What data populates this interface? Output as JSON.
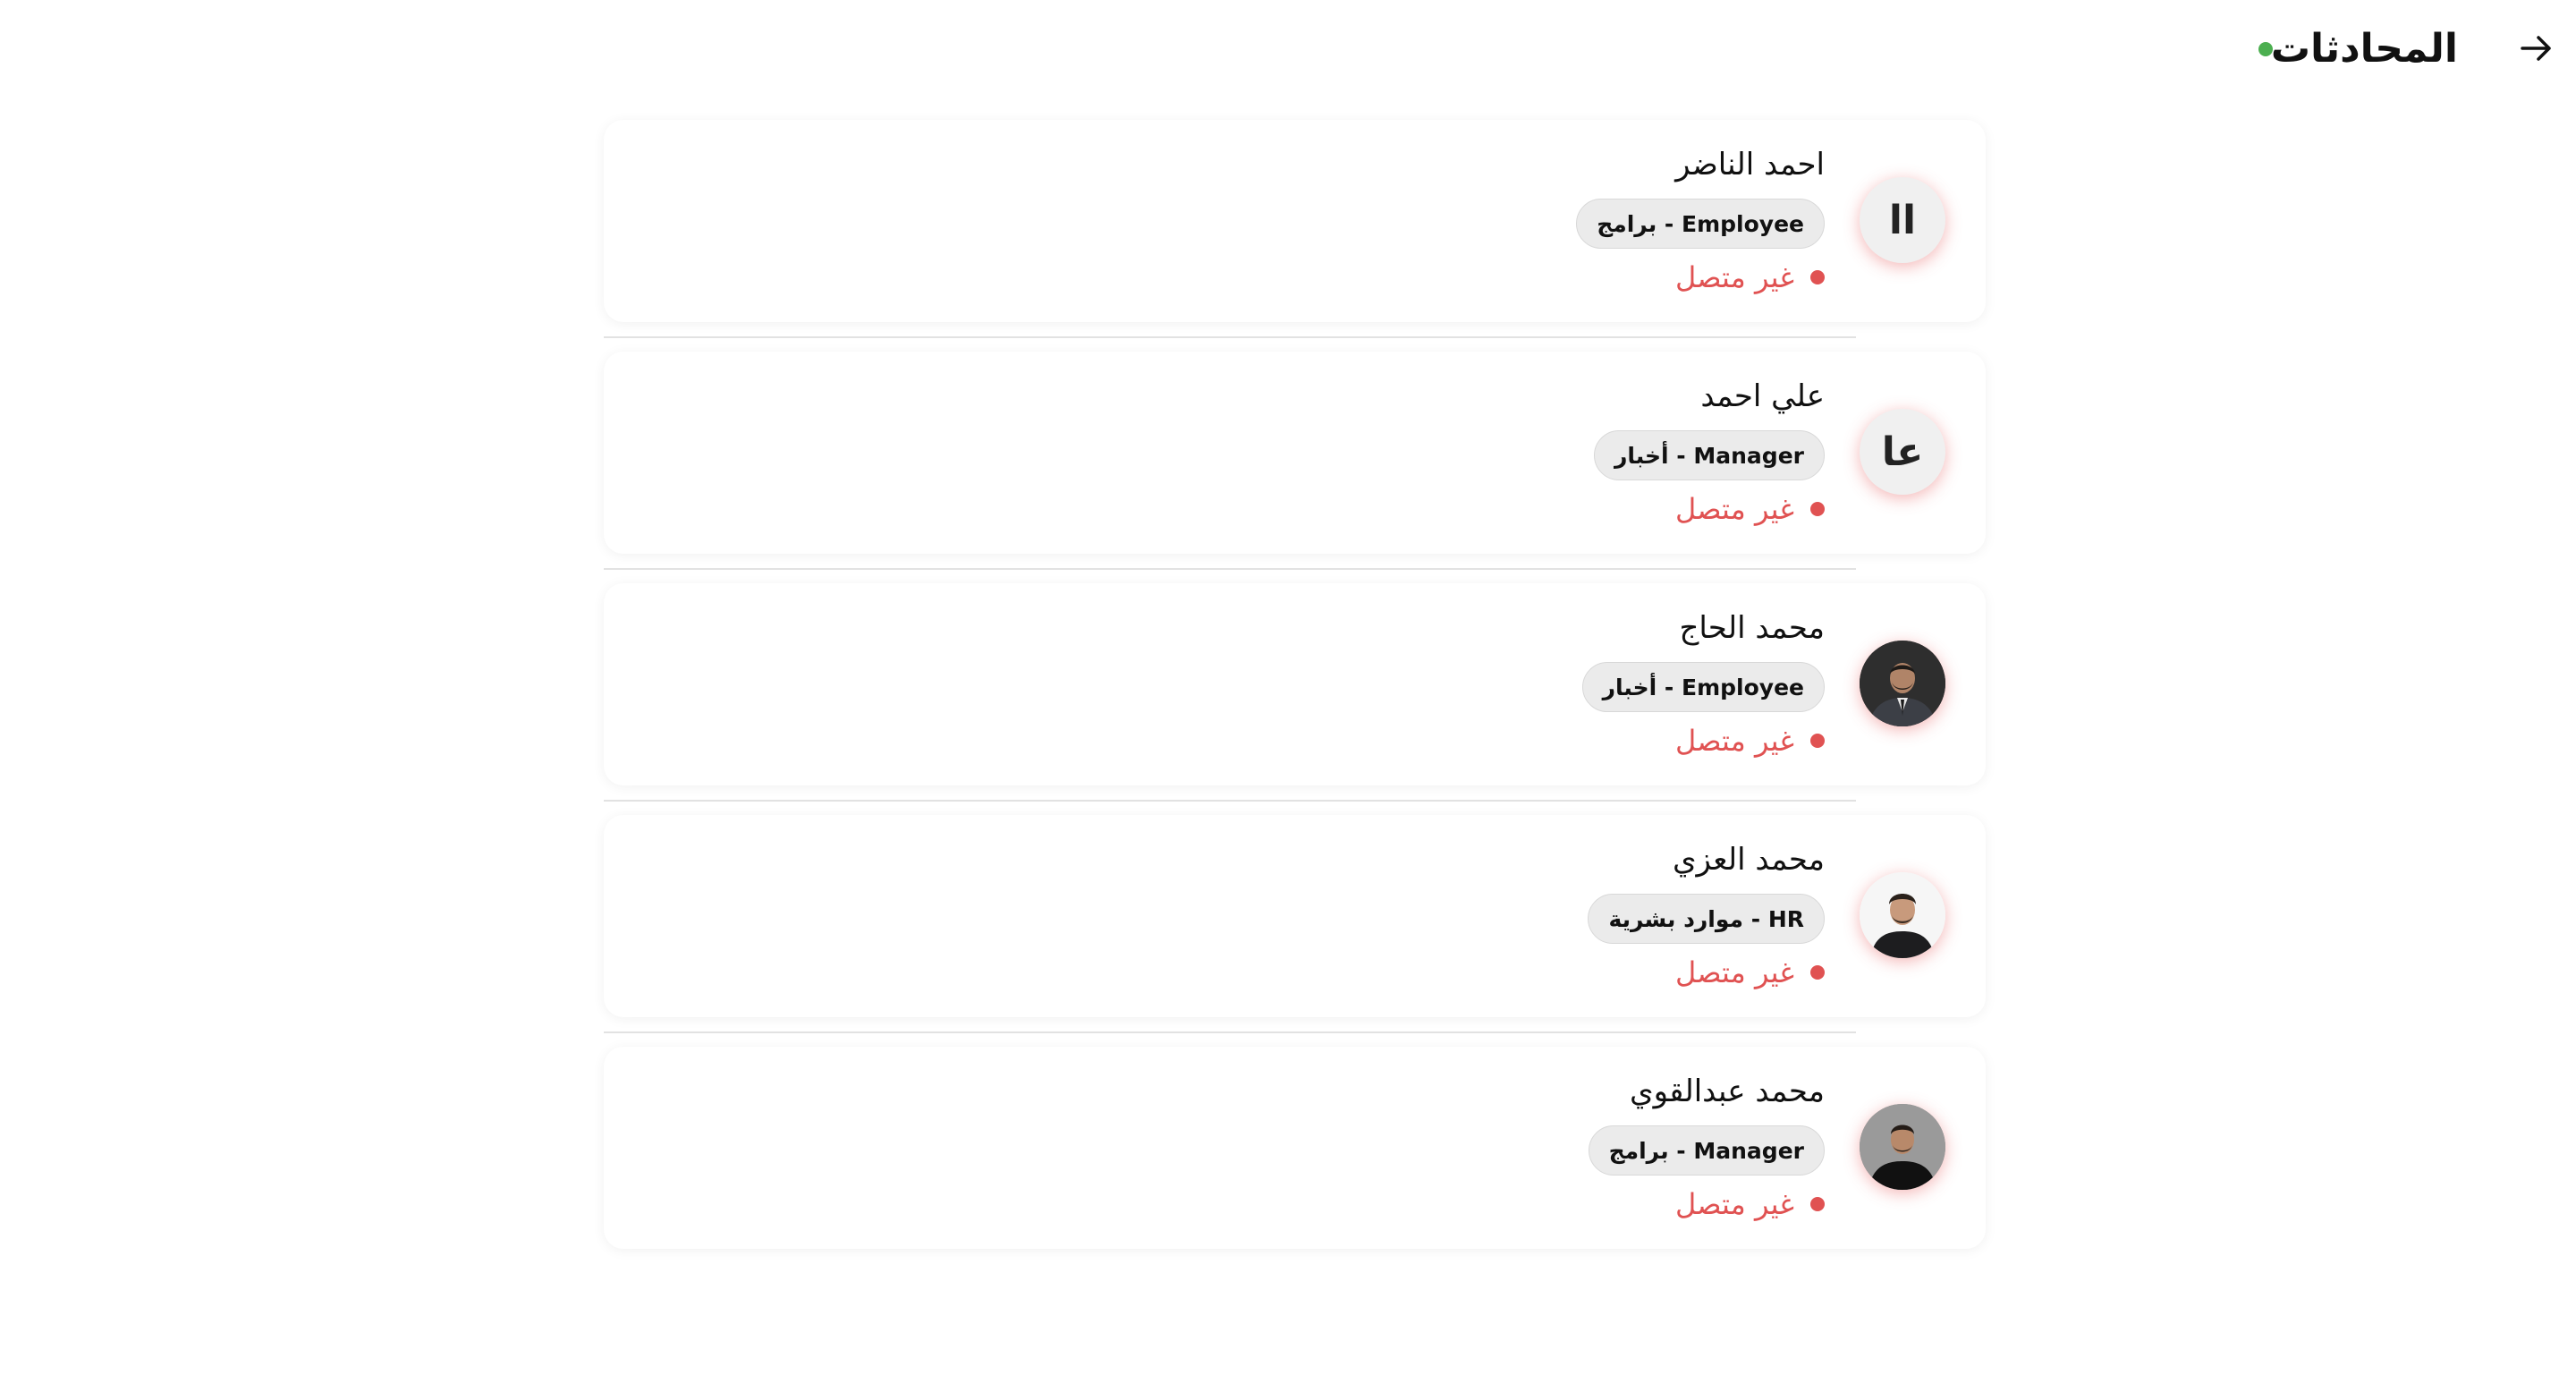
{
  "header": {
    "title": "المحادثات",
    "back_icon": "arrow-right-icon",
    "online_indicator_color": "#4caf50"
  },
  "colors": {
    "offline": "#e05252",
    "avatar_glow": "#e55353",
    "tag_bg": "#ebebeb"
  },
  "contacts": [
    {
      "name": "احمد الناضر",
      "tag": "Employee - برامج",
      "status": "غير متصل",
      "initials": "اا",
      "avatar_type": "initials"
    },
    {
      "name": "علي احمد",
      "tag": "Manager - أخبار",
      "status": "غير متصل",
      "initials": "عا",
      "avatar_type": "initials"
    },
    {
      "name": "محمد الحاج",
      "tag": "Employee - أخبار",
      "status": "غير متصل",
      "avatar_type": "photo"
    },
    {
      "name": "محمد العزي",
      "tag": "HR - موارد بشرية",
      "status": "غير متصل",
      "avatar_type": "photo"
    },
    {
      "name": "محمد عبدالقوي",
      "tag": "Manager - برامج",
      "status": "غير متصل",
      "avatar_type": "photo"
    }
  ]
}
